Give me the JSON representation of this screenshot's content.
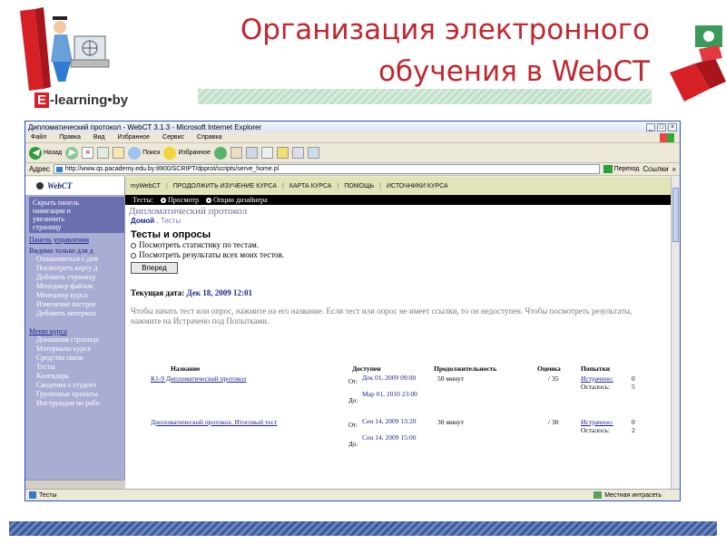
{
  "slide": {
    "title_line1": "Организация электронного",
    "title_line2": "обучения в WebCT",
    "logo_e": "E",
    "logo_rest": "-learning•by"
  },
  "browser": {
    "title": "Дипломатический протокол - WebCT 3.1.3 - Microsoft Internet Explorer",
    "menu": [
      "Файл",
      "Правка",
      "Вид",
      "Избранное",
      "Сервис",
      "Справка"
    ],
    "toolbar": {
      "back": "Назад",
      "search": "Поиск",
      "favorites": "Избранное"
    },
    "address_label": "Адрес",
    "address": "http://www.qs.pacademy.edu.by:8900/SCRIPT/dpprot/scripts/serve_home.pl",
    "go": "Переход",
    "links": "Ссылки",
    "status_left": "Тесты",
    "status_right": "Местная интрасеть"
  },
  "webct": {
    "logo": "WebCT",
    "topnav": [
      "myWebCT",
      "ПРОДОЛЖИТЬ ИЗУЧЕНИЕ КУРСА",
      "КАРТА КУРСА",
      "ПОМОЩЬ",
      "ИСТОЧНИКИ КУРСА"
    ],
    "tabs_label": "Тесты:",
    "tab_view": "Просмотр",
    "tab_design": "Опции дизайнера",
    "page_heading": "Дипломатический протокол",
    "crumb_home": "Домой",
    "crumb_current": "Тесты",
    "section_heading": "Тесты и опросы",
    "option1": "Посмотреть статистику по тестам.",
    "option2": "Посмотреть результаты всех моих тестов.",
    "next_button": "Вперед",
    "current_date_label": "Текущая дата:",
    "current_date": "Дек 18, 2009 12:01",
    "info": "Чтобы начать тест или опрос, нажмите на его название. Если тест или опрос не имеет ссылки, то он недоступен. Чтобы посмотреть результаты, нажмите на Истрачено под Попытками.",
    "columns": [
      "Название",
      "Доступен",
      "Продолжительность",
      "Оценка",
      "Попытки"
    ],
    "rows": [
      {
        "name": "К1-9 Дипломатический протокол",
        "from_label": "От:",
        "from": "Дек 01, 2009 09:00",
        "to_label": "До:",
        "to": "Мар 01, 2010 23:00",
        "duration": "50 минут",
        "score": "/ 35",
        "used": "Истрачено:",
        "used_n": "0",
        "left": "Осталось:",
        "left_n": "5"
      },
      {
        "name": "Дипломатический протокол. Итоговый тест",
        "from_label": "От:",
        "from": "Сен 14, 2009 13:20",
        "to_label": "До:",
        "to": "Сен 14, 2009 15:00",
        "duration": "30 минут",
        "score": "/ 30",
        "used": "Истрачено:",
        "used_n": "0",
        "left": "Осталось:",
        "left_n": "2"
      }
    ],
    "sidebar": {
      "hide_panel": "Скрыть панель навигации и увеличить страницу",
      "control_panel": "Панель управления",
      "visible_note": "Видима только для д",
      "control_items": [
        "Ознакомиться с дем",
        "Посмотреть карту д",
        "Добавить страницу",
        "Менеджер файлов",
        "Менеджер курса",
        "Изменение настрое",
        "Добавить материал"
      ],
      "course_menu": "Меню курса",
      "course_items": [
        "Домашняя страница",
        "Материалы курса",
        "Средства связи",
        "Тесты",
        "Календарь",
        "Сведения о студент",
        "Групповые проекты",
        "Инструкции по рабо"
      ]
    }
  }
}
